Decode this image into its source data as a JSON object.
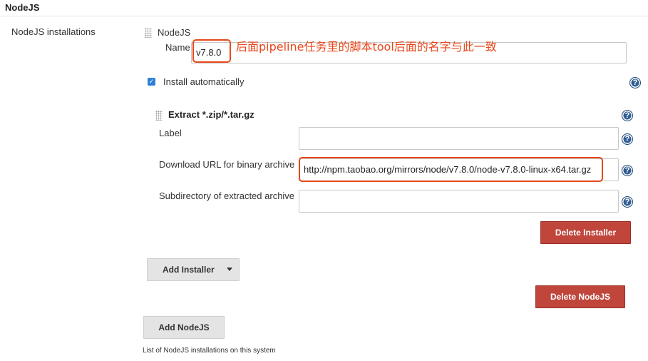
{
  "section": {
    "title": "NodeJS",
    "installations_label": "NodeJS installations"
  },
  "nodejs": {
    "header": "NodeJS",
    "name_label": "Name",
    "name_value": "v7.8.0",
    "annotation": "后面pipeline任务里的脚本tool后面的名字与此一致",
    "install_automatically_label": "Install automatically",
    "install_automatically_checked": true,
    "help_glyph": "?"
  },
  "installer": {
    "title": "Extract *.zip/*.tar.gz",
    "label_field_label": "Label",
    "label_field_value": "",
    "url_label": "Download URL for binary archive",
    "url_value": "http://npm.taobao.org/mirrors/node/v7.8.0/node-v7.8.0-linux-x64.tar.gz",
    "subdir_label": "Subdirectory of extracted archive",
    "subdir_value": "",
    "delete_installer_button": "Delete Installer"
  },
  "buttons": {
    "add_installer": "Add Installer",
    "delete_nodejs": "Delete NodeJS",
    "add_nodejs": "Add NodeJS"
  },
  "footer": {
    "description": "List of NodeJS installations on this system"
  },
  "colors": {
    "annotation_red": "#e8471a",
    "danger_button": "#c0463c",
    "checkbox_blue": "#2e7fd6",
    "help_icon_blue": "#2f5d92"
  },
  "icons": {
    "drag_handle": "drag-handle-icon",
    "help": "help-icon",
    "checkbox": "check-icon",
    "dropdown": "chevron-down-icon"
  }
}
